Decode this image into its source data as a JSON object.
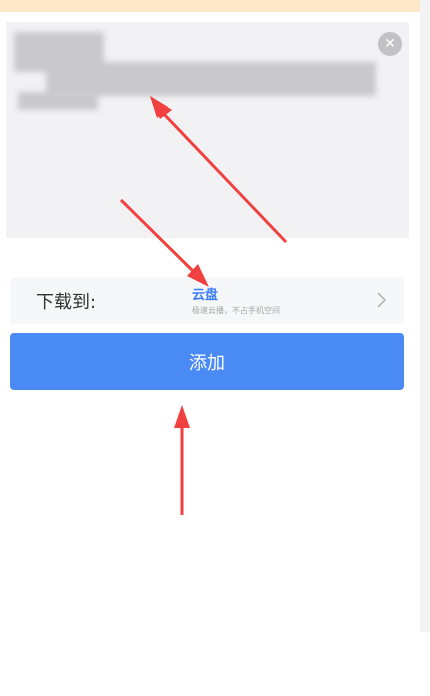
{
  "download_to": {
    "label": "下载到:",
    "destination": "云盘",
    "destination_description": "极速云播，不占手机空间"
  },
  "add_button": {
    "label": "添加"
  },
  "icons": {
    "clear": "close-circle-icon",
    "chevron": "chevron-right-icon"
  },
  "colors": {
    "accent": "#4a8af4",
    "destination_text": "#3a7cf5",
    "annotation_arrow": "#f04040",
    "top_banner": "#fde9c7"
  }
}
